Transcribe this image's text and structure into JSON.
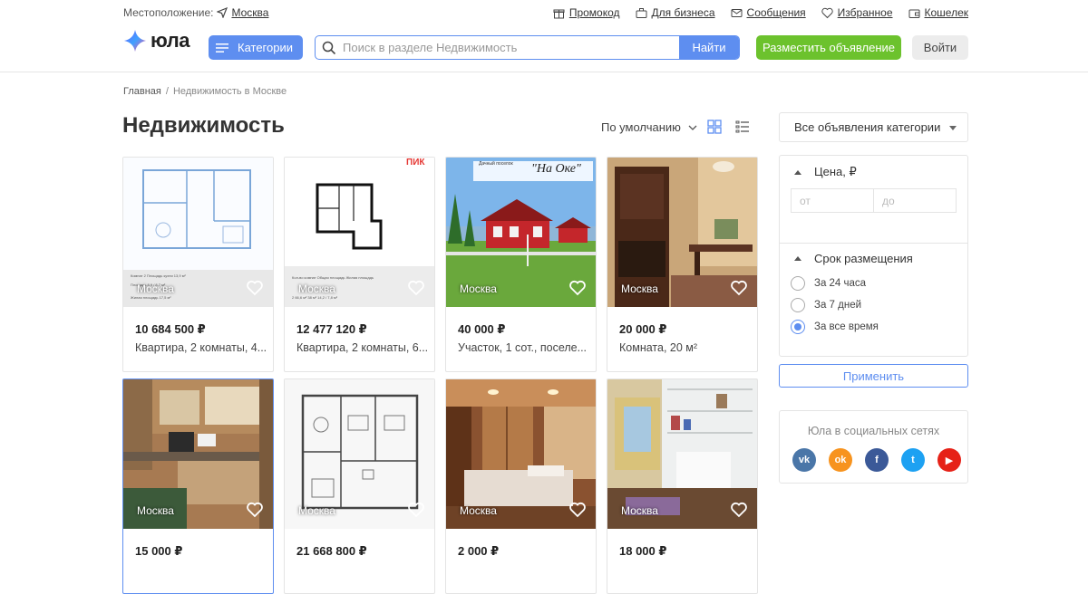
{
  "topbar": {
    "location_label": "Местоположение:",
    "location_city": "Москва",
    "links": [
      {
        "label": "Промокод",
        "icon": "gift-icon"
      },
      {
        "label": "Для бизнеса",
        "icon": "briefcase-icon"
      },
      {
        "label": "Сообщения",
        "icon": "envelope-icon"
      },
      {
        "label": "Избранное",
        "icon": "heart-icon"
      },
      {
        "label": "Кошелек",
        "icon": "wallet-icon"
      }
    ]
  },
  "header": {
    "logo_text": "юла",
    "categories_label": "Категории",
    "search_placeholder": "Поиск в разделе Недвижимость",
    "search_button": "Найти",
    "post_button": "Разместить объявление",
    "login_button": "Войти"
  },
  "breadcrumb": {
    "home": "Главная",
    "separator": "/",
    "current": "Недвижимость в Москве"
  },
  "page_title": "Недвижимость",
  "sort_label": "По умолчанию",
  "listings": [
    {
      "city": "Москва",
      "price": "10 684 500 ₽",
      "desc": "Квартира, 2 комнаты, 4..."
    },
    {
      "city": "Москва",
      "price": "12 477 120 ₽",
      "desc": "Квартира, 2 комнаты, 6..."
    },
    {
      "city": "Москва",
      "price": "40 000 ₽",
      "desc": "Участок, 1 сот., поселе..."
    },
    {
      "city": "Москва",
      "price": "20 000 ₽",
      "desc": "Комната, 20 м²"
    },
    {
      "city": "Москва",
      "price": "15 000 ₽",
      "desc": ""
    },
    {
      "city": "Москва",
      "price": "21 668 800 ₽",
      "desc": ""
    },
    {
      "city": "Москва",
      "price": "2 000 ₽",
      "desc": ""
    },
    {
      "city": "Москва",
      "price": "18 000 ₽",
      "desc": ""
    }
  ],
  "image_texts": {
    "pik_logo": "ПИК",
    "village_caption": "Дачный поселок",
    "village_name": "\"На Оке\""
  },
  "sidebar": {
    "category_select": "Все объявления категории",
    "price_heading": "Цена, ₽",
    "price_from_placeholder": "от",
    "price_to_placeholder": "до",
    "period_heading": "Срок размещения",
    "periods": [
      "За 24 часа",
      "За 7 дней",
      "За все время"
    ],
    "selected_period_index": 2,
    "apply_button": "Применить",
    "social_title": "Юла в социальных сетях",
    "social": [
      {
        "name": "vk",
        "label": "vk",
        "color": "#4a76a8"
      },
      {
        "name": "odnoklassniki",
        "label": "ok",
        "color": "#f7931e"
      },
      {
        "name": "facebook",
        "label": "f",
        "color": "#3b5998"
      },
      {
        "name": "twitter",
        "label": "t",
        "color": "#1da1f2"
      },
      {
        "name": "youtube",
        "label": "▶",
        "color": "#e62117"
      }
    ]
  },
  "colors": {
    "accent": "#5e8ef0",
    "post": "#6cc22d",
    "logo_gradient": [
      "#6a5cff",
      "#ff4fa3"
    ]
  }
}
